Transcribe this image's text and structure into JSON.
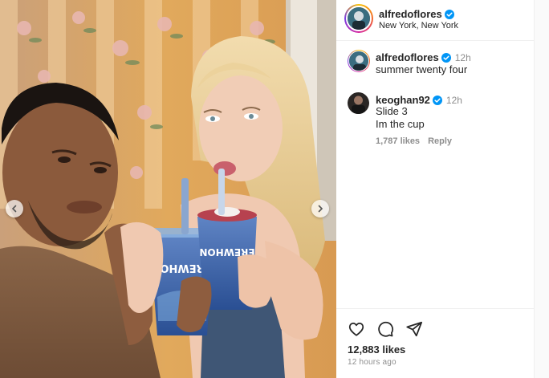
{
  "post": {
    "author": "alfredoflores",
    "location": "New York, New York",
    "verified": true,
    "cup_text": "EREWHON",
    "likes": "12,883 likes",
    "posted_ago": "12 hours ago"
  },
  "comments": [
    {
      "username": "alfredoflores",
      "verified": true,
      "time": "12h",
      "lines": [
        "summer twenty four"
      ],
      "likes": "",
      "reply_label": ""
    },
    {
      "username": "keoghan92",
      "verified": true,
      "time": "12h",
      "lines": [
        "Slide 3",
        "Im the cup"
      ],
      "likes": "1,787 likes",
      "reply_label": "Reply"
    }
  ],
  "icons": {
    "like": "heart-icon",
    "comment": "comment-bubble-icon",
    "share": "paper-plane-icon",
    "prev": "chevron-left-icon",
    "next": "chevron-right-icon",
    "verified": "verified-badge-icon"
  },
  "colors": {
    "verified": "#0095f6",
    "secondary_text": "#8e8e8e",
    "primary_text": "#262626"
  }
}
